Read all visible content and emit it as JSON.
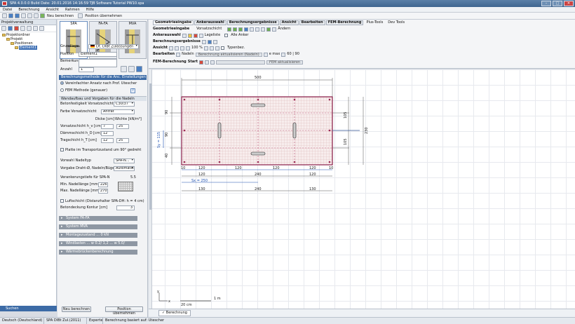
{
  "window": {
    "title": "SPA 4.0.0.0   Build Date: 20.01.2016 14:16:59   TJB Software Tutorial PW10.spa",
    "min_label": "–",
    "max_label": "□",
    "close_label": "✕"
  },
  "menu": [
    "Datei",
    "Berechnung",
    "Ansicht",
    "Rahmen",
    "Hilfe"
  ],
  "toolbar": {
    "neu_berechnen": "Neu berechnen",
    "position_uebernehmen": "Position übernehmen"
  },
  "tree": {
    "header": "Projektverwaltung",
    "items": [
      {
        "label": "Projektordner"
      },
      {
        "label": "Projekt"
      },
      {
        "label": "Positionen"
      },
      {
        "label": "Element1"
      }
    ],
    "footer": "Suchen"
  },
  "props": {
    "mode_tabs": [
      "SPA",
      "FA-FA",
      "MVA"
    ],
    "grundlage_label": "Grundlage",
    "grundlage_value": "Dt. DIBt Zulassungen",
    "position_label": "Position",
    "position_value": "Element1",
    "bemerkung_label": "Bemerkung",
    "anzahl_label": "Anzahl",
    "anzahl_value": "1",
    "section_method": "Berechnungsmethode für die Anc. Einstellungen",
    "radio1": "Vereinfachter Ansatz nach Prof. Utescher",
    "radio2": "FEM Methode (genauer)",
    "help": "?",
    "section_wall": "Wandaufbau und Vorgaben für die Nadeln",
    "beton_label": "Betonfestigkeit Vorsatzschicht",
    "beton_value": "C30/37",
    "farbe_label": "Farbe Vorsatzschicht",
    "farbe_value": "Antrat",
    "dicke_header": "Dicke [cm]",
    "wichte_header": "Wichte [kN/m³]",
    "vorsatz_label": "Vorsatzschicht  h_v [cm]",
    "vorsatz_d": "7",
    "vorsatz_w": "25",
    "daemm_label": "Dämmschicht  h_D [cm]",
    "daemm_d": "12",
    "trag_label": "Tragschicht  h_T [cm]",
    "trag_d": "12",
    "trag_w": "25",
    "platte_chk": "Platte im Transportzustand um 90° gedreht",
    "nadeltyp_label": "Vorwahl Nadeltyp",
    "nadeltyp_value": "SPA-N...",
    "draht_label": "Vorgabe Draht-Ø, Nadeln/Bügel",
    "draht_value": "Automatik",
    "veranker_label": "Verankerungstiefe für SPA-N",
    "veranker_value": "5.5",
    "minnadel_label": "Min. Nadellänge [mm]",
    "minnadel_value": "226",
    "maxnadel_label": "Max. Nadellänge [mm]",
    "maxnadel_value": "270",
    "luft_chk": "Luftschicht (Distanzhalter SPA-DH: h = 4 cm)",
    "betondeck_label": "Betondeckung Kontur  [cm]",
    "betondeck_value": "3",
    "collapsed": [
      "System FA-FA",
      "System MVA",
      "Montagezustand ... 0 kN",
      "Windlasten ... w 0.2/ 1,2 ... w 5.0/",
      "Wärmebrückenberechnung"
    ],
    "btn_neu": "Neu berechnen",
    "btn_pos": "Position übernehmen"
  },
  "ribbon": {
    "tabs": [
      "Geometrieeingabe",
      "Ankerauswahl",
      "Berechnungsergebnisse",
      "Ansicht",
      "Bearbeiten",
      "FEM-Berechnung",
      "Plus-Tools",
      "Dev Tools"
    ],
    "row1_label": "Geometrieeingabe",
    "row1_sub": "Vorsatzschicht",
    "row1_aendern": "Ändern",
    "row2_label": "Ankerauswahl",
    "row2_lagel": "Lageliste",
    "row2_alle": "Alle Anker",
    "row3_label": "Berechnungsergebnisse",
    "row4_label": "Ansicht",
    "row4_zoom": "100 %",
    "row4_typen": "Typenbez.",
    "row5_label": "Bearbeiten",
    "row5_nadeln": "Nadeln",
    "row5_bar": "Berechnung aktualisieren (Nadeln)",
    "row5_emax": "e max",
    "row5_vals": "60 | 90",
    "row6_label": "FEM-Berechnung",
    "row6_start": "Start",
    "row6_bar": "FEM aktualisieren"
  },
  "drawing": {
    "dims": {
      "top": "500",
      "left_small": [
        "90",
        "90",
        "40"
      ],
      "right_a": "105",
      "right_b": "105",
      "right_total": "230",
      "sy": "Sy = 115",
      "bottom_edges": [
        "10",
        "10"
      ],
      "bottom_row1": [
        "120",
        "120",
        "120",
        "120"
      ],
      "bottom_row2": [
        "120",
        "240",
        "120"
      ],
      "sx": "Sx = 250",
      "bottom_row3": [
        "130",
        "240",
        "130"
      ]
    },
    "scale_label": "1 m",
    "scale_sub": "20 cm",
    "axis_y": "y",
    "axis_x": "x"
  },
  "canvas_tab": "Berechnung",
  "status": {
    "lang": "Deutsch (Deutschland)",
    "norm": "SPA DIBt Zul.(2011)",
    "mode": "Experte",
    "calc": "Berechnung basiert auf:  Utescher"
  }
}
